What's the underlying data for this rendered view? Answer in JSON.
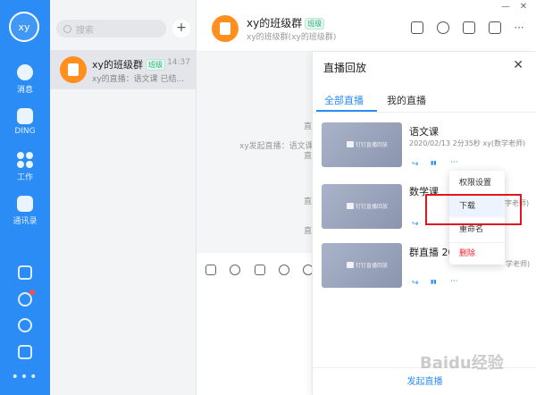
{
  "nav": {
    "avatar": "xy",
    "items": [
      {
        "label": "消息",
        "icon": "chat-bubble-icon"
      },
      {
        "label": "DING",
        "icon": "ding-icon"
      },
      {
        "label": "工作",
        "icon": "grid-apps-icon"
      },
      {
        "label": "通讯录",
        "icon": "contacts-icon"
      }
    ],
    "more": "•••"
  },
  "conversations": {
    "search_placeholder": "搜索",
    "add_label": "+",
    "items": [
      {
        "name": "xy的班级群",
        "tag": "班级",
        "time": "14:37",
        "preview": "xy的直播：语文课 已结..."
      }
    ]
  },
  "chat": {
    "title": "xy的班级群",
    "tag": "班级",
    "subtitle": "xy的班级群(xy的班级群)",
    "system_messages": [
      "xy发起直播：语文课，",
      "直",
      "直",
      "直",
      "直"
    ]
  },
  "window": {
    "minimize": "—",
    "close": "✕"
  },
  "replay_panel": {
    "title": "直播回放",
    "close": "✕",
    "tabs": [
      "全部直播",
      "我的直播"
    ],
    "thumbnail_text": "钉钉直播回放",
    "videos": [
      {
        "title": "语文课",
        "meta": "2020/02/13 2分35秒 xy(数学老师)"
      },
      {
        "title": "数学课",
        "meta": "字老师)"
      },
      {
        "title": "群直播 20",
        "meta": "学老师)"
      }
    ],
    "actions": {
      "share": "↪",
      "stats": "▮▮",
      "more": "···"
    },
    "footer": "发起直播"
  },
  "context_menu": {
    "items": [
      "权限设置",
      "下载",
      "重命名",
      "删除"
    ]
  },
  "watermark": "Baidu经验"
}
